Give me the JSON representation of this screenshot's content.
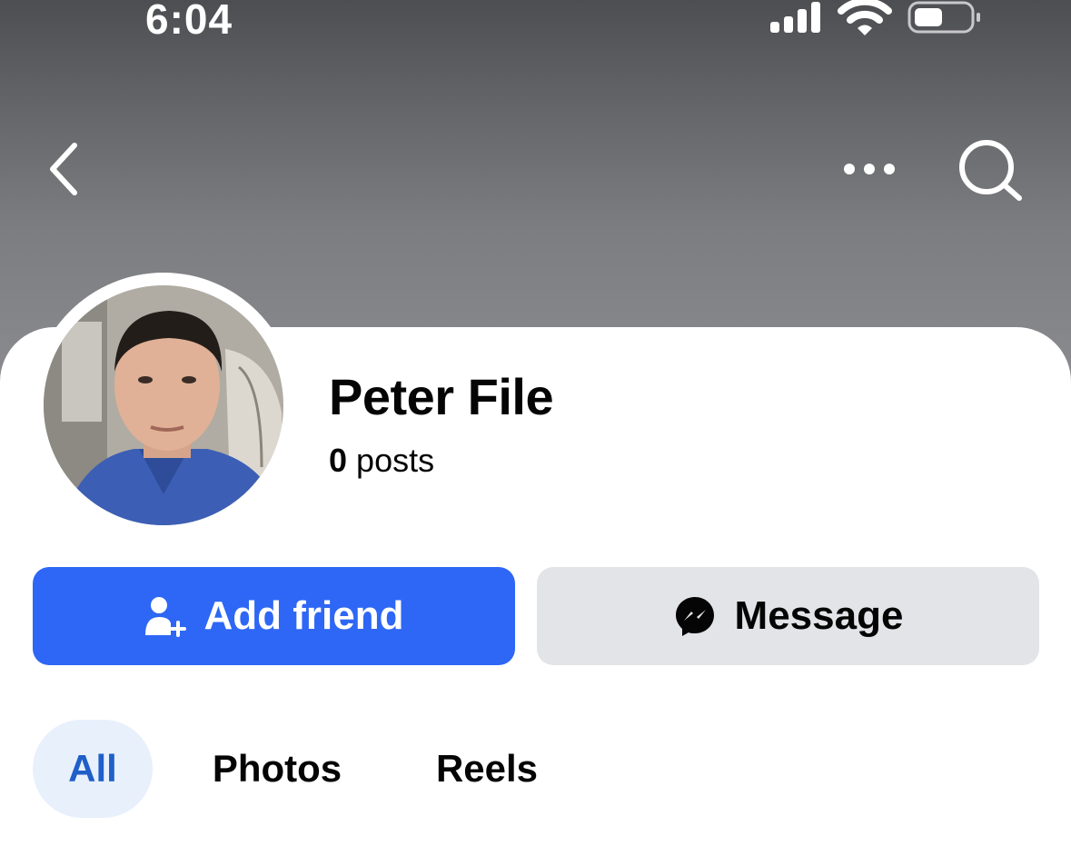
{
  "status_bar": {
    "time": "6:04",
    "signal_icon": "cellular-signal-icon",
    "wifi_icon": "wifi-icon",
    "battery_icon": "battery-icon"
  },
  "header": {
    "back_icon": "chevron-left-icon",
    "more_icon": "more-horizontal-icon",
    "search_icon": "search-icon"
  },
  "profile": {
    "name": "Peter File",
    "post_count": "0",
    "post_label": "posts"
  },
  "actions": {
    "add_friend_label": "Add friend",
    "add_friend_icon": "person-add-icon",
    "message_label": "Message",
    "message_icon": "messenger-icon"
  },
  "tabs": [
    {
      "label": "All",
      "selected": true
    },
    {
      "label": "Photos",
      "selected": false
    },
    {
      "label": "Reels",
      "selected": false
    }
  ],
  "colors": {
    "primary_button": "#2e67f5",
    "secondary_button": "#e3e4e8",
    "selected_tab_bg": "#e8f0fc",
    "selected_tab_text": "#1f5fc8"
  }
}
